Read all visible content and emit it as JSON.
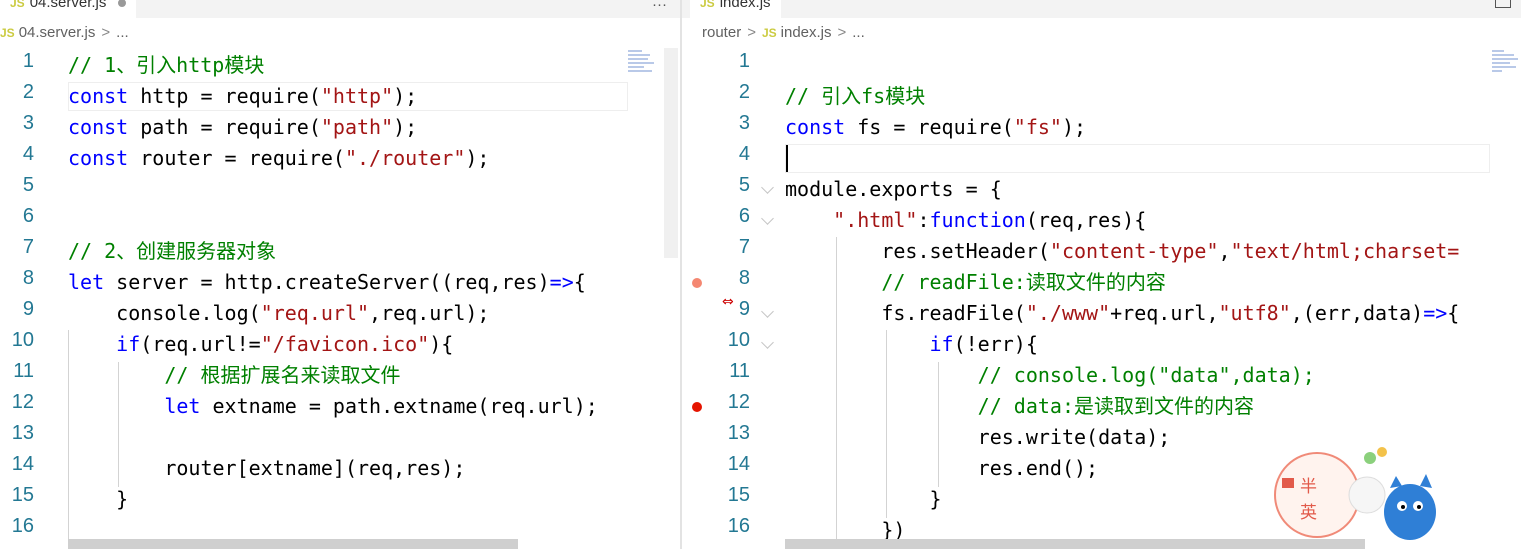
{
  "left_editor": {
    "tab_label": "04.server.js",
    "tab_icon": "JS",
    "breadcrumb": {
      "icon": "JS",
      "file": "04.server.js",
      "chevron": ">",
      "more": "..."
    },
    "line_numbers": [
      "1",
      "2",
      "3",
      "4",
      "5",
      "6",
      "7",
      "8",
      "9",
      "10",
      "11",
      "12",
      "13",
      "14",
      "15",
      "16"
    ],
    "lines": [
      [
        {
          "t": "// 1、引入http模块",
          "c": "c"
        }
      ],
      [
        {
          "t": "const",
          "c": "k"
        },
        {
          "t": " http = require(",
          "c": ""
        },
        {
          "t": "\"http\"",
          "c": "s"
        },
        {
          "t": ");",
          "c": ""
        }
      ],
      [
        {
          "t": "const",
          "c": "k"
        },
        {
          "t": " path = require(",
          "c": ""
        },
        {
          "t": "\"path\"",
          "c": "s"
        },
        {
          "t": ");",
          "c": ""
        }
      ],
      [
        {
          "t": "const",
          "c": "k"
        },
        {
          "t": " router = require(",
          "c": ""
        },
        {
          "t": "\"./router\"",
          "c": "s"
        },
        {
          "t": ");",
          "c": ""
        }
      ],
      [],
      [],
      [
        {
          "t": "// 2、创建服务器对象",
          "c": "c"
        }
      ],
      [
        {
          "t": "let",
          "c": "k"
        },
        {
          "t": " server = http.createServer((req,res)",
          "c": ""
        },
        {
          "t": "=>",
          "c": "k"
        },
        {
          "t": "{",
          "c": ""
        }
      ],
      [
        {
          "t": "    console.log(",
          "c": ""
        },
        {
          "t": "\"req.url\"",
          "c": "s"
        },
        {
          "t": ",req.url);",
          "c": ""
        }
      ],
      [
        {
          "t": "    ",
          "c": ""
        },
        {
          "t": "if",
          "c": "k"
        },
        {
          "t": "(req.url!=",
          "c": ""
        },
        {
          "t": "\"/favicon.ico\"",
          "c": "s"
        },
        {
          "t": "){",
          "c": ""
        }
      ],
      [
        {
          "t": "        ",
          "c": ""
        },
        {
          "t": "// 根据扩展名来读取文件",
          "c": "c"
        }
      ],
      [
        {
          "t": "        ",
          "c": ""
        },
        {
          "t": "let",
          "c": "k"
        },
        {
          "t": " extname = path.extname(req.url);",
          "c": ""
        }
      ],
      [],
      [
        {
          "t": "        router[extname](req,res);",
          "c": ""
        }
      ],
      [
        {
          "t": "    }",
          "c": ""
        }
      ],
      []
    ]
  },
  "right_editor": {
    "tab_label": "index.js",
    "tab_icon": "JS",
    "breadcrumb": {
      "folder": "router",
      "icon": "JS",
      "file": "index.js",
      "chevron": ">",
      "more": "..."
    },
    "line_numbers": [
      "1",
      "2",
      "3",
      "4",
      "5",
      "6",
      "7",
      "8",
      "9",
      "10",
      "11",
      "12",
      "13",
      "14",
      "15",
      "16"
    ],
    "lines": [
      [],
      [
        {
          "t": "// 引入fs模块",
          "c": "c"
        }
      ],
      [
        {
          "t": "const",
          "c": "k"
        },
        {
          "t": " fs = require(",
          "c": ""
        },
        {
          "t": "\"fs\"",
          "c": "s"
        },
        {
          "t": ");",
          "c": ""
        }
      ],
      [],
      [
        {
          "t": "module.exports = {",
          "c": ""
        }
      ],
      [
        {
          "t": "    ",
          "c": ""
        },
        {
          "t": "\".html\"",
          "c": "s"
        },
        {
          "t": ":",
          "c": ""
        },
        {
          "t": "function",
          "c": "k"
        },
        {
          "t": "(req,res){",
          "c": ""
        }
      ],
      [
        {
          "t": "        res.setHeader(",
          "c": ""
        },
        {
          "t": "\"content-type\"",
          "c": "s"
        },
        {
          "t": ",",
          "c": ""
        },
        {
          "t": "\"text/html;charset=",
          "c": "s"
        }
      ],
      [
        {
          "t": "        ",
          "c": ""
        },
        {
          "t": "// readFile:读取文件的内容",
          "c": "c"
        }
      ],
      [
        {
          "t": "        fs.readFile(",
          "c": ""
        },
        {
          "t": "\"./www\"",
          "c": "s"
        },
        {
          "t": "+req.url,",
          "c": ""
        },
        {
          "t": "\"utf8\"",
          "c": "s"
        },
        {
          "t": ",(err,data)",
          "c": ""
        },
        {
          "t": "=>",
          "c": "k"
        },
        {
          "t": "{",
          "c": ""
        }
      ],
      [
        {
          "t": "            ",
          "c": ""
        },
        {
          "t": "if",
          "c": "k"
        },
        {
          "t": "(!err){",
          "c": ""
        }
      ],
      [
        {
          "t": "                ",
          "c": ""
        },
        {
          "t": "// console.log(\"data\",data);",
          "c": "c"
        }
      ],
      [
        {
          "t": "                ",
          "c": ""
        },
        {
          "t": "// data:是读取到文件的内容",
          "c": "c"
        }
      ],
      [
        {
          "t": "                res.write(data);",
          "c": ""
        }
      ],
      [
        {
          "t": "                res.end();",
          "c": ""
        }
      ],
      [
        {
          "t": "            }",
          "c": ""
        }
      ],
      [
        {
          "t": "        })",
          "c": ""
        }
      ]
    ],
    "breakpoints": [
      {
        "line": "8",
        "state": "unverified",
        "color": "#f48771"
      },
      {
        "line": "12",
        "state": "active",
        "color": "#e51400"
      }
    ]
  },
  "sticker": {
    "text_top": "半",
    "text_bottom": "英"
  },
  "colors": {
    "keyword": "#0000ff",
    "string": "#a31515",
    "comment": "#008000",
    "line_number": "#237893"
  }
}
